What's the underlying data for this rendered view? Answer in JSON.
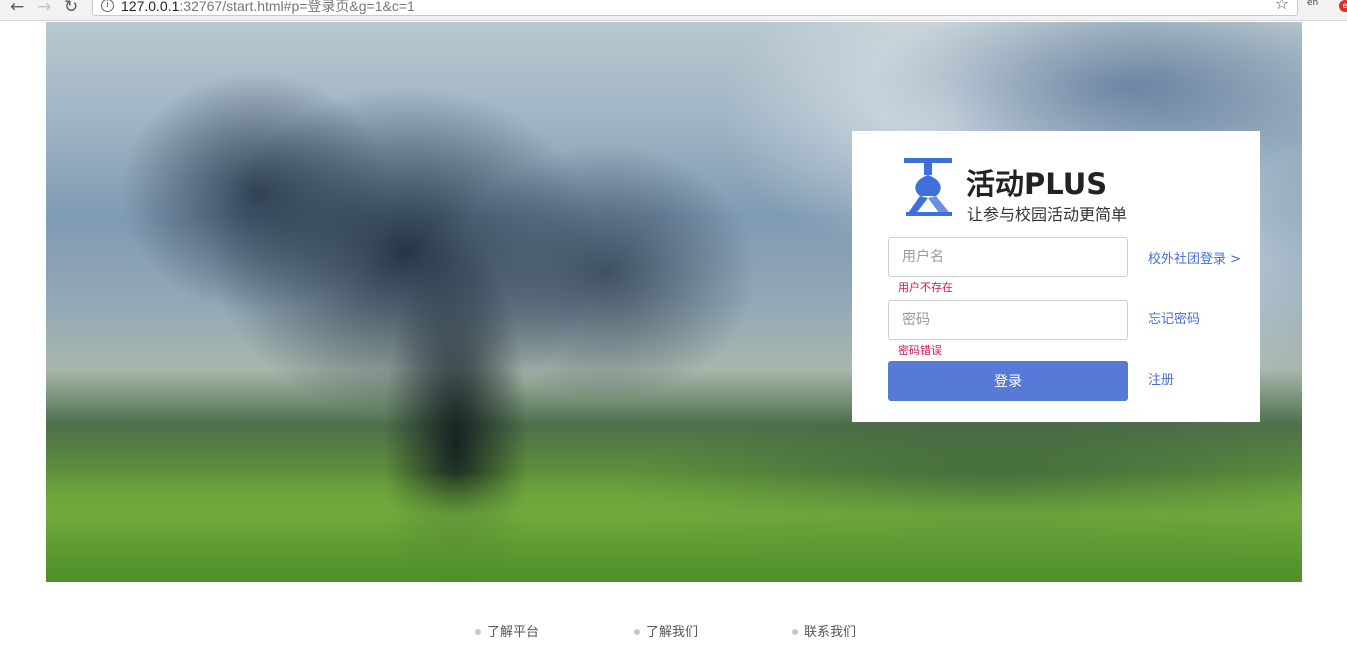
{
  "browser": {
    "back_icon": "←",
    "forward_icon": "→",
    "reload_icon": "↻",
    "info_icon": "i",
    "url_host": "127.0.0.1",
    "url_rest": ":32767/start.html#p=登录页&g=1&c=1",
    "star_icon": "☆",
    "ext_label": "en",
    "ext_badge": "e"
  },
  "login": {
    "brand_title": "活动PLUS",
    "slogan": "让参与校园活动更简单",
    "username_placeholder": "用户名",
    "username_error": "用户不存在",
    "password_placeholder": "密码",
    "password_error": "密码错误",
    "login_button": "登录",
    "club_login_link": "校外社团登录 >",
    "forgot_password_link": "忘记密码",
    "register_link": "注册",
    "logo_color": "#3f6fd8"
  },
  "footer": {
    "items": [
      "了解平台",
      "了解我们",
      "联系我们"
    ]
  }
}
